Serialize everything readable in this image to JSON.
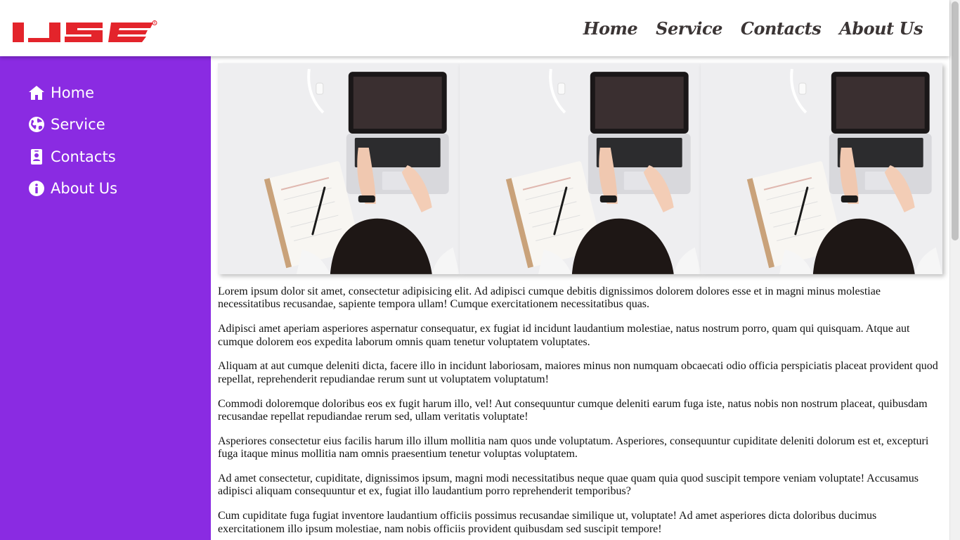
{
  "brand": {
    "logo_text": "IJSE",
    "logo_color": "#e3242b"
  },
  "top_nav": {
    "items": [
      {
        "label": "Home"
      },
      {
        "label": "Service"
      },
      {
        "label": "Contacts"
      },
      {
        "label": "About Us"
      }
    ]
  },
  "sidebar": {
    "background": "#8a2be2",
    "items": [
      {
        "label": "Home",
        "icon": "home-icon"
      },
      {
        "label": "Service",
        "icon": "globe-icon"
      },
      {
        "label": "Contacts",
        "icon": "contact-card-icon"
      },
      {
        "label": "About Us",
        "icon": "info-icon"
      }
    ]
  },
  "gallery": {
    "images": [
      {
        "subject": "person-using-laptop-photo"
      },
      {
        "subject": "person-using-laptop-photo"
      },
      {
        "subject": "person-using-laptop-photo"
      }
    ]
  },
  "content": {
    "paragraphs": [
      "Lorem ipsum dolor sit amet, consectetur adipisicing elit. Ad adipisci cumque debitis dignissimos dolorem dolores esse et in magni minus molestiae necessitatibus recusandae, sapiente tempora ullam! Cumque exercitationem necessitatibus quas.",
      "Adipisci amet aperiam asperiores aspernatur consequatur, ex fugiat id incidunt laudantium molestiae, natus nostrum porro, quam qui quisquam. Atque aut cumque dolorem eos expedita laborum omnis quam tenetur voluptatem voluptates.",
      "Aliquam at aut cumque deleniti dicta, facere illo in incidunt laboriosam, maiores minus non numquam obcaecati odio officia perspiciatis placeat provident quod repellat, reprehenderit repudiandae rerum sunt ut voluptatem voluptatum!",
      "Commodi doloremque doloribus eos ex fugit harum illo, vel! Aut consequuntur cumque deleniti earum fuga iste, natus nobis non nostrum placeat, quibusdam recusandae repellat repudiandae rerum sed, ullam veritatis voluptate!",
      "Asperiores consectetur eius facilis harum illo illum mollitia nam quos unde voluptatum. Asperiores, consequuntur cupiditate deleniti dolorum est et, excepturi fuga itaque minus mollitia nam omnis praesentium tenetur voluptas voluptatem.",
      "Ad amet consectetur, cupiditate, dignissimos ipsum, magni modi necessitatibus neque quae quam quia quod suscipit tempore veniam voluptate! Accusamus adipisci aliquam consequuntur et ex, fugiat illo laudantium porro reprehenderit temporibus?",
      "Cum cupiditate fuga fugiat inventore laudantium officiis possimus recusandae similique ut, voluptate! Ad amet asperiores dicta doloribus ducimus exercitationem illo ipsum molestiae, nam nobis officiis provident quibusdam sed suscipit tempore!"
    ]
  }
}
